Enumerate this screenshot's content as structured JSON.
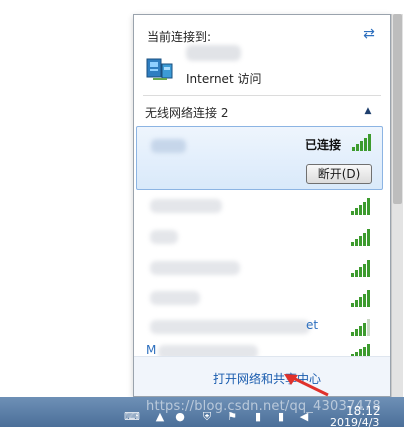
{
  "popup": {
    "header_title": "当前连接到:",
    "internet_access": "Internet 访问",
    "section_title": "无线网络连接 2",
    "selected": {
      "status": "已连接",
      "disconnect_button": "断开(D)"
    },
    "network_tail_text": "et",
    "network_tail_text_2": "M",
    "footer_link": "打开网络和共享中心"
  },
  "taskbar": {
    "clock_time": "18:12",
    "clock_date": "2019/4/3",
    "watermark": "https://blog.csdn.net/qq_43037478"
  },
  "colors": {
    "accent": "#1a5cae",
    "signal": "#3d9b2e",
    "taskbar": "#4b6f99"
  },
  "icons": [
    "refresh-icon",
    "network-icon",
    "collapse-icon",
    "signal-icon",
    "arrow-icon",
    "keyboard-icon",
    "qq-icon",
    "shield-icon",
    "flag-icon",
    "volume-icon"
  ]
}
